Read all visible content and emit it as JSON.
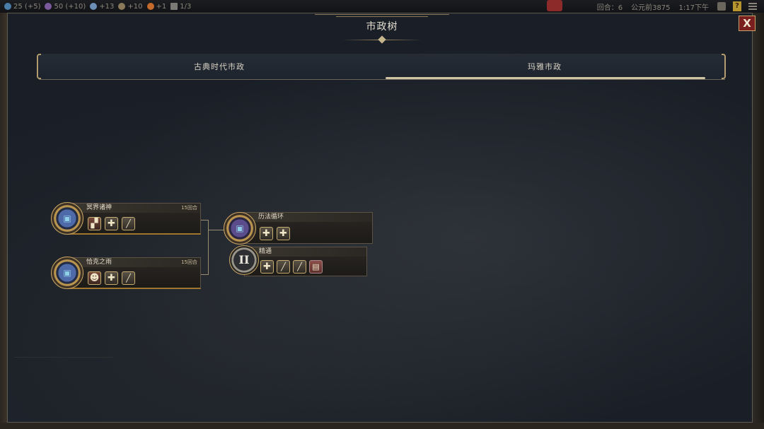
{
  "topbar": {
    "science": "25",
    "science_rate": "(+5)",
    "culture": "50",
    "culture_rate": "(+10)",
    "faith": "+13",
    "production": "+10",
    "gold": "+1",
    "cities": "1/3",
    "turn": "回合：6",
    "year": "公元前3875",
    "time": "1:17下午",
    "help_label": "?"
  },
  "window": {
    "title": "市政树",
    "close_label": "X"
  },
  "tabs": [
    {
      "label": "古典时代市政",
      "active": false
    },
    {
      "label": "玛雅市政",
      "active": true
    }
  ],
  "civics": [
    {
      "name": "冥界诸神",
      "turns": "15回合",
      "slots": [
        "unit-portrait-icon",
        "plus-icon",
        "pen-icon"
      ]
    },
    {
      "name": "恰克之雨",
      "turns": "15回合",
      "slots": [
        "character-portrait-icon",
        "plus-icon",
        "pen-icon"
      ]
    },
    {
      "name": "历法循环",
      "turns": "",
      "slots": [
        "plus-icon",
        "plus-icon"
      ]
    },
    {
      "name": "精通",
      "turns": "",
      "tier": "II",
      "slots": [
        "plus-icon",
        "pen-icon",
        "pen-icon",
        "book-icon"
      ]
    }
  ],
  "colors": {
    "accent_gold": "#b8944f",
    "close_red": "#7a1e1e",
    "panel_bg": "#1a1f27"
  }
}
